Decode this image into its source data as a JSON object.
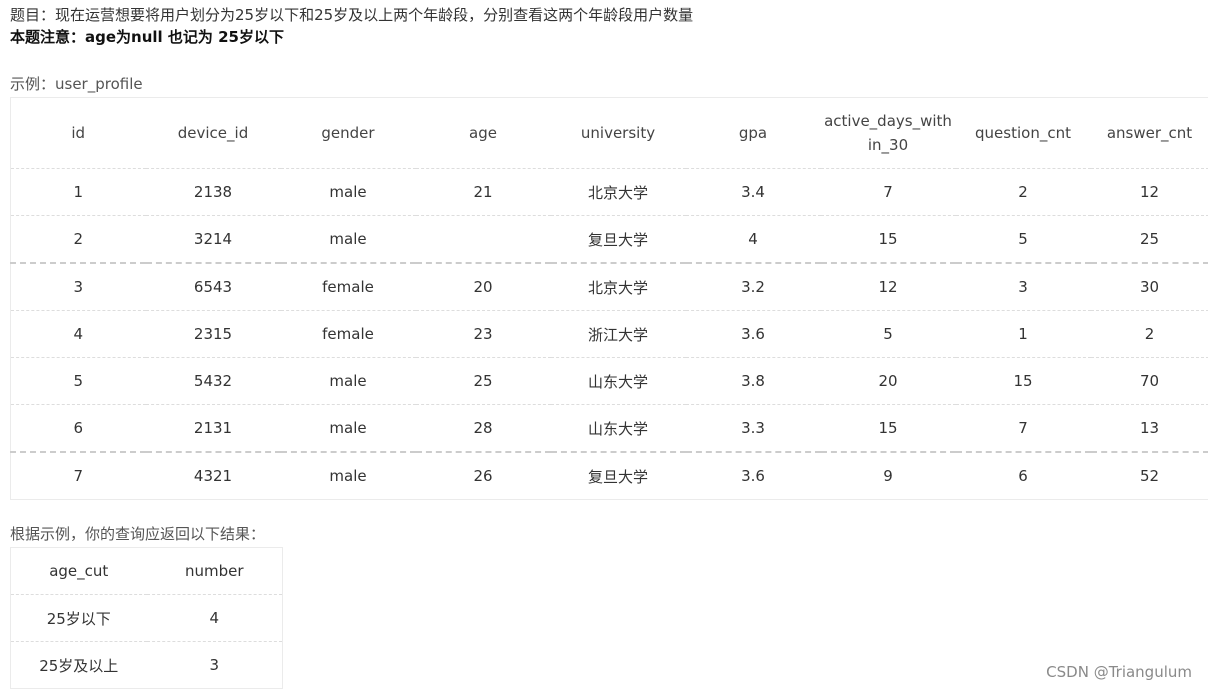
{
  "question": "题目：现在运营想要将用户划分为25岁以下和25岁及以上两个年龄段，分别查看这两个年龄段用户数量",
  "note": "本题注意：age为null 也记为 25岁以下",
  "example_label": "示例：user_profile",
  "profile_table": {
    "columns": [
      "id",
      "device_id",
      "gender",
      "age",
      "university",
      "gpa",
      "active_days_within_30",
      "question_cnt",
      "answer_cnt"
    ],
    "rows": [
      [
        "1",
        "2138",
        "male",
        "21",
        "北京大学",
        "3.4",
        "7",
        "2",
        "12"
      ],
      [
        "2",
        "3214",
        "male",
        "",
        "复旦大学",
        "4",
        "15",
        "5",
        "25"
      ],
      [
        "3",
        "6543",
        "female",
        "20",
        "北京大学",
        "3.2",
        "12",
        "3",
        "30"
      ],
      [
        "4",
        "2315",
        "female",
        "23",
        "浙江大学",
        "3.6",
        "5",
        "1",
        "2"
      ],
      [
        "5",
        "5432",
        "male",
        "25",
        "山东大学",
        "3.8",
        "20",
        "15",
        "70"
      ],
      [
        "6",
        "2131",
        "male",
        "28",
        "山东大学",
        "3.3",
        "15",
        "7",
        "13"
      ],
      [
        "7",
        "4321",
        "male",
        "26",
        "复旦大学",
        "3.6",
        "9",
        "6",
        "52"
      ]
    ]
  },
  "result_label": "根据示例，你的查询应返回以下结果：",
  "result_table": {
    "columns": [
      "age_cut",
      "number"
    ],
    "rows": [
      [
        "25岁以下",
        "4"
      ],
      [
        "25岁及以上",
        "3"
      ]
    ]
  },
  "watermark": "CSDN @Triangulum"
}
